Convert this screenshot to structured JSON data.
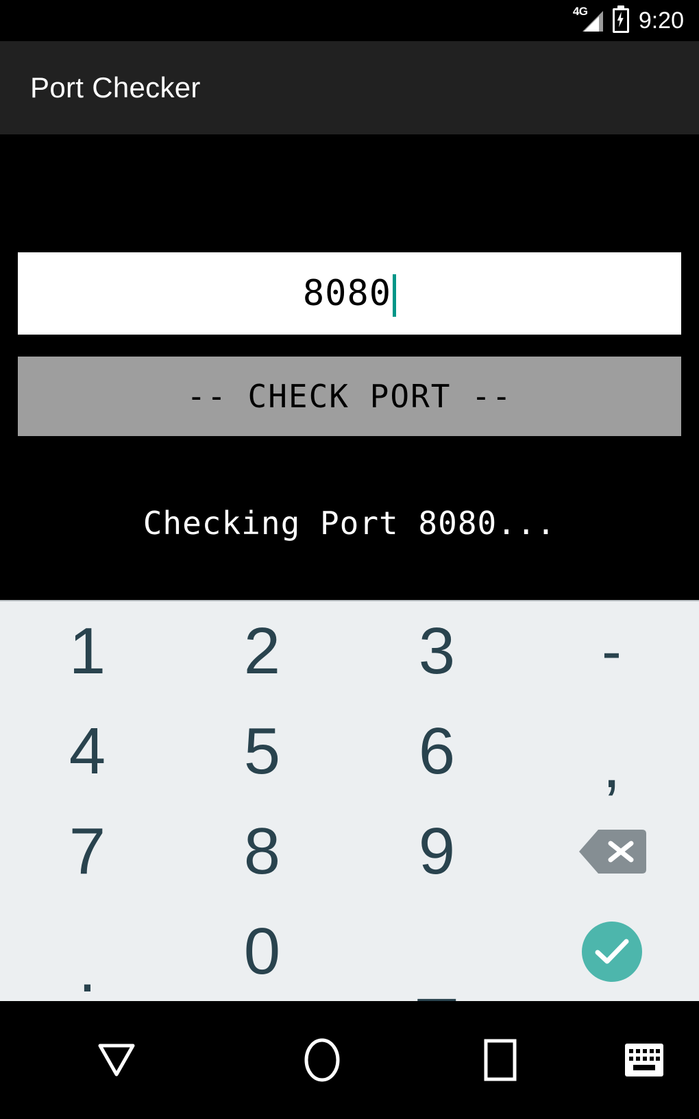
{
  "status_bar": {
    "network_label": "4G",
    "signal_icon": "signal-bars-icon",
    "battery_icon": "battery-charging-icon",
    "time": "9:20"
  },
  "action_bar": {
    "title": "Port Checker",
    "background_color": "#212121"
  },
  "app": {
    "background_color": "#000000",
    "port_field": {
      "value": "8080",
      "placeholder": "",
      "caret_color": "#009688",
      "background_color": "#ffffff"
    },
    "check_button": {
      "label": "-- CHECK PORT --",
      "background_color": "#9e9e9e",
      "text_color": "#000000"
    },
    "status_message": "Checking Port 8080...",
    "status_message_color": "#ffffff"
  },
  "keyboard": {
    "background_color": "#eceff1",
    "key_color": "#29434e",
    "accent_color": "#4db6ac",
    "rows": [
      [
        {
          "label": "1",
          "name": "key-1",
          "kind": "text"
        },
        {
          "label": "2",
          "name": "key-2",
          "kind": "text"
        },
        {
          "label": "3",
          "name": "key-3",
          "kind": "text"
        },
        {
          "label": "-",
          "name": "key-dash",
          "kind": "text"
        }
      ],
      [
        {
          "label": "4",
          "name": "key-4",
          "kind": "text"
        },
        {
          "label": "5",
          "name": "key-5",
          "kind": "text"
        },
        {
          "label": "6",
          "name": "key-6",
          "kind": "text"
        },
        {
          "label": ",",
          "name": "key-comma",
          "kind": "text"
        }
      ],
      [
        {
          "label": "7",
          "name": "key-7",
          "kind": "text"
        },
        {
          "label": "8",
          "name": "key-8",
          "kind": "text"
        },
        {
          "label": "9",
          "name": "key-9",
          "kind": "text"
        },
        {
          "label": "",
          "name": "key-backspace",
          "kind": "backspace"
        }
      ],
      [
        {
          "label": ".",
          "name": "key-period",
          "kind": "text"
        },
        {
          "label": "0",
          "name": "key-0",
          "kind": "text"
        },
        {
          "label": "_",
          "name": "key-underscore",
          "kind": "text"
        },
        {
          "label": "",
          "name": "key-enter",
          "kind": "enter"
        }
      ]
    ]
  },
  "nav_bar": {
    "background_color": "#000000",
    "items": [
      {
        "name": "nav-back-icon",
        "glyph": "triangle-down"
      },
      {
        "name": "nav-home-icon",
        "glyph": "circle"
      },
      {
        "name": "nav-recents-icon",
        "glyph": "square"
      },
      {
        "name": "nav-keyboard-icon",
        "glyph": "keyboard"
      }
    ]
  }
}
